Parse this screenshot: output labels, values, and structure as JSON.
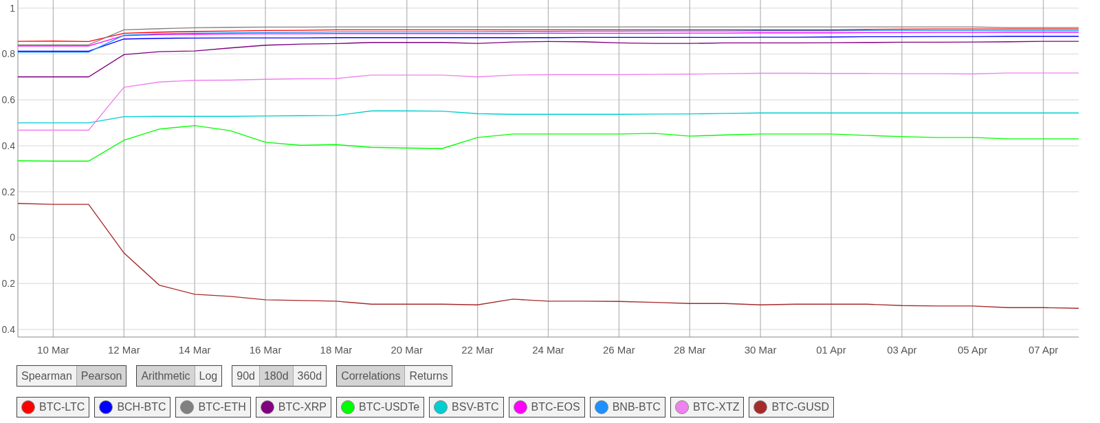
{
  "chart": {
    "chart_data": {
      "type": "line",
      "categories": [
        null,
        "10 Mar",
        null,
        "12 Mar",
        null,
        "14 Mar",
        null,
        "16 Mar",
        null,
        "18 Mar",
        null,
        "20 Mar",
        null,
        "22 Mar",
        null,
        "24 Mar",
        null,
        "26 Mar",
        null,
        "28 Mar",
        null,
        "30 Mar",
        null,
        "01 Apr",
        null,
        "03 Apr",
        null,
        "05 Apr",
        null,
        "07 Apr",
        null
      ],
      "ylim": [
        -0.433,
        1.035
      ],
      "grid": true,
      "yticks": [
        1,
        {
          "value": 0.8,
          "label": "0.8"
        },
        {
          "value": 0.6,
          "label": "0.6"
        },
        {
          "value": 0.4,
          "label": "0.4"
        },
        {
          "value": 0.2,
          "label": "0.2"
        },
        0,
        {
          "value": -0.2,
          "label": "0.2"
        },
        {
          "value": -0.4,
          "label": "0.4"
        }
      ],
      "series": [
        {
          "name": "BTC-LTC",
          "color": "#ff0000",
          "values": [
            0.855,
            0.856,
            0.854,
            0.89,
            0.895,
            0.898,
            0.9,
            0.902,
            0.903,
            0.905,
            0.905,
            0.905,
            0.905,
            0.905,
            0.905,
            0.905,
            0.905,
            0.905,
            0.905,
            0.905,
            0.905,
            0.905,
            0.905,
            0.905,
            0.907,
            0.908,
            0.909,
            0.909,
            0.909,
            0.909,
            0.909
          ]
        },
        {
          "name": "BCH-BTC",
          "color": "#0000ff",
          "values": [
            0.812,
            0.812,
            0.812,
            0.865,
            0.868,
            0.869,
            0.87,
            0.87,
            0.87,
            0.871,
            0.871,
            0.871,
            0.871,
            0.871,
            0.871,
            0.871,
            0.872,
            0.872,
            0.872,
            0.872,
            0.872,
            0.873,
            0.873,
            0.874,
            0.875,
            0.875,
            0.876,
            0.876,
            0.877,
            0.877,
            0.877
          ]
        },
        {
          "name": "BTC-ETH",
          "color": "#808080",
          "values": [
            0.84,
            0.84,
            0.84,
            0.905,
            0.91,
            0.914,
            0.916,
            0.917,
            0.917,
            0.918,
            0.918,
            0.918,
            0.918,
            0.918,
            0.918,
            0.918,
            0.918,
            0.918,
            0.918,
            0.918,
            0.918,
            0.918,
            0.918,
            0.918,
            0.918,
            0.918,
            0.918,
            0.918,
            0.915,
            0.915,
            0.915
          ]
        },
        {
          "name": "BTC-XRP",
          "color": "#800080",
          "values": [
            0.7,
            0.7,
            0.7,
            0.797,
            0.81,
            0.813,
            0.826,
            0.838,
            0.843,
            0.845,
            0.85,
            0.85,
            0.85,
            0.846,
            0.852,
            0.854,
            0.853,
            0.848,
            0.846,
            0.846,
            0.848,
            0.848,
            0.848,
            0.849,
            0.85,
            0.851,
            0.851,
            0.852,
            0.853,
            0.855,
            0.855
          ]
        },
        {
          "name": "BTC-USDTe",
          "color": "#00ff00",
          "values": [
            0.335,
            0.333,
            0.333,
            0.424,
            0.473,
            0.488,
            0.466,
            0.415,
            0.402,
            0.405,
            0.393,
            0.39,
            0.388,
            0.436,
            0.451,
            0.451,
            0.451,
            0.451,
            0.454,
            0.442,
            0.447,
            0.451,
            0.451,
            0.451,
            0.445,
            0.44,
            0.436,
            0.436,
            0.43,
            0.43,
            0.43
          ]
        },
        {
          "name": "BSV-BTC",
          "color": "#00ced1",
          "values": [
            0.5,
            0.5,
            0.5,
            0.527,
            0.528,
            0.528,
            0.528,
            0.53,
            0.531,
            0.532,
            0.552,
            0.552,
            0.551,
            0.54,
            0.537,
            0.537,
            0.537,
            0.537,
            0.538,
            0.539,
            0.541,
            0.543,
            0.543,
            0.543,
            0.543,
            0.543,
            0.543,
            0.543,
            0.543,
            0.543,
            0.543
          ]
        },
        {
          "name": "BTC-EOS",
          "color": "#ff00ff",
          "values": [
            0.835,
            0.835,
            0.835,
            0.88,
            0.884,
            0.886,
            0.887,
            0.888,
            0.888,
            0.889,
            0.889,
            0.889,
            0.889,
            0.889,
            0.889,
            0.89,
            0.89,
            0.89,
            0.89,
            0.891,
            0.891,
            0.892,
            0.892,
            0.892,
            0.893,
            0.893,
            0.894,
            0.894,
            0.895,
            0.895,
            0.895
          ]
        },
        {
          "name": "BNB-BTC",
          "color": "#1e90ff",
          "values": [
            0.808,
            0.808,
            0.808,
            0.882,
            0.888,
            0.89,
            0.892,
            0.893,
            0.894,
            0.896,
            0.896,
            0.896,
            0.896,
            0.897,
            0.898,
            0.898,
            0.899,
            0.899,
            0.9,
            0.9,
            0.9,
            0.901,
            0.901,
            0.901,
            0.902,
            0.902,
            0.902,
            0.902,
            0.902,
            0.902,
            0.902
          ]
        },
        {
          "name": "BTC-XTZ",
          "color": "#ee82ee",
          "values": [
            0.468,
            0.468,
            0.468,
            0.655,
            0.678,
            0.685,
            0.686,
            0.69,
            0.692,
            0.693,
            0.708,
            0.708,
            0.708,
            0.7,
            0.708,
            0.71,
            0.71,
            0.71,
            0.711,
            0.712,
            0.714,
            0.716,
            0.716,
            0.715,
            0.715,
            0.714,
            0.714,
            0.713,
            0.717,
            0.717,
            0.717
          ]
        },
        {
          "name": "BTC-GUSD",
          "color": "#a52a2a",
          "values": [
            0.149,
            0.145,
            0.145,
            -0.067,
            -0.207,
            -0.247,
            -0.256,
            -0.271,
            -0.274,
            -0.277,
            -0.29,
            -0.29,
            -0.29,
            -0.293,
            -0.268,
            -0.277,
            -0.277,
            -0.278,
            -0.282,
            -0.287,
            -0.287,
            -0.293,
            -0.29,
            -0.29,
            -0.29,
            -0.296,
            -0.298,
            -0.298,
            -0.305,
            -0.305,
            -0.308
          ]
        }
      ]
    }
  },
  "controls": [
    {
      "buttons": [
        {
          "label": "Spearman",
          "selected": false
        },
        {
          "label": "Pearson",
          "selected": true
        }
      ]
    },
    {
      "buttons": [
        {
          "label": "Arithmetic",
          "selected": true
        },
        {
          "label": "Log",
          "selected": false
        }
      ]
    },
    {
      "buttons": [
        {
          "label": "90d",
          "selected": false
        },
        {
          "label": "180d",
          "selected": true
        },
        {
          "label": "360d",
          "selected": false
        }
      ]
    },
    {
      "buttons": [
        {
          "label": "Correlations",
          "selected": true
        },
        {
          "label": "Returns",
          "selected": false
        }
      ]
    }
  ]
}
